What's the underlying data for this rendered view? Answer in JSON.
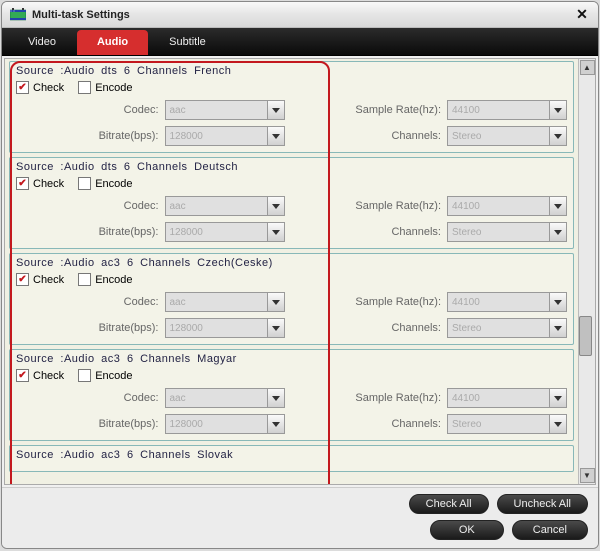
{
  "window": {
    "title": "Multi-task Settings"
  },
  "tabs": {
    "video": "Video",
    "audio": "Audio",
    "subtitle": "Subtitle",
    "active": "audio"
  },
  "labels": {
    "check": "Check",
    "encode": "Encode",
    "codec": "Codec:",
    "bitrate": "Bitrate(bps):",
    "samplerate": "Sample Rate(hz):",
    "channels": "Channels:"
  },
  "defaults": {
    "codec": "aac",
    "bitrate": "128000",
    "samplerate": "44100",
    "channels": "Stereo"
  },
  "sources": [
    {
      "title": "Source :Audio dts 6 Channels French",
      "check": true,
      "encode": false
    },
    {
      "title": "Source :Audio dts 6 Channels Deutsch",
      "check": true,
      "encode": false
    },
    {
      "title": "Source :Audio ac3 6 Channels Czech(Ceske)",
      "check": true,
      "encode": false
    },
    {
      "title": "Source :Audio ac3 6 Channels Magyar",
      "check": true,
      "encode": false
    },
    {
      "title": "Source :Audio ac3 6 Channels Slovak",
      "check": true,
      "encode": false
    }
  ],
  "buttons": {
    "checkall": "Check All",
    "uncheckall": "Uncheck All",
    "ok": "OK",
    "cancel": "Cancel"
  }
}
